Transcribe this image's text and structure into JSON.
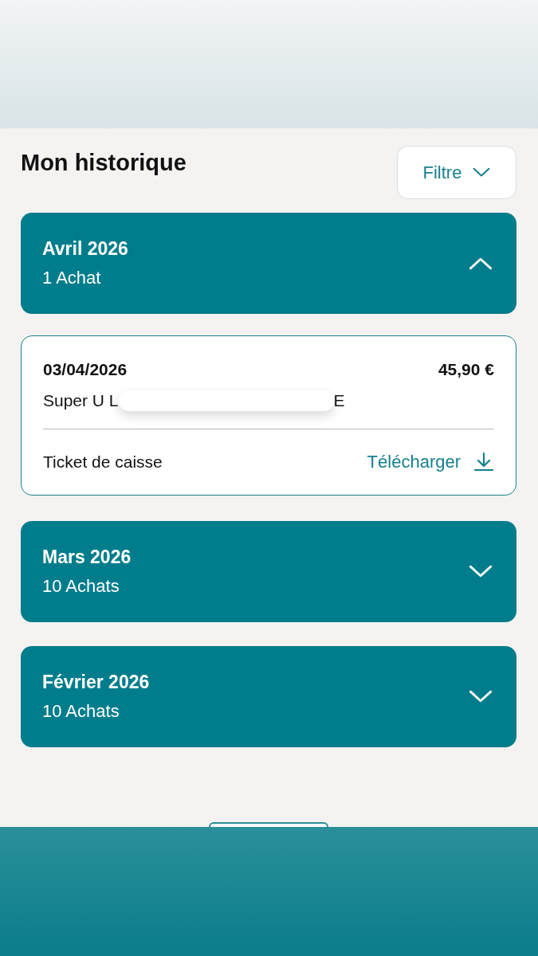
{
  "title": "Mon historique",
  "filter": {
    "label": "Filtre"
  },
  "months": [
    {
      "label": "Avril 2026",
      "count": "1 Achat",
      "expanded": true,
      "purchases": [
        {
          "date": "03/04/2026",
          "amount": "45,90 €",
          "store_start": "Super U L",
          "store_end": "E",
          "ticket_label": "Ticket de caisse",
          "download_label": "Télécharger"
        }
      ]
    },
    {
      "label": "Mars 2026",
      "count": "10 Achats",
      "expanded": false
    },
    {
      "label": "Février 2026",
      "count": "10 Achats",
      "expanded": false
    }
  ]
}
